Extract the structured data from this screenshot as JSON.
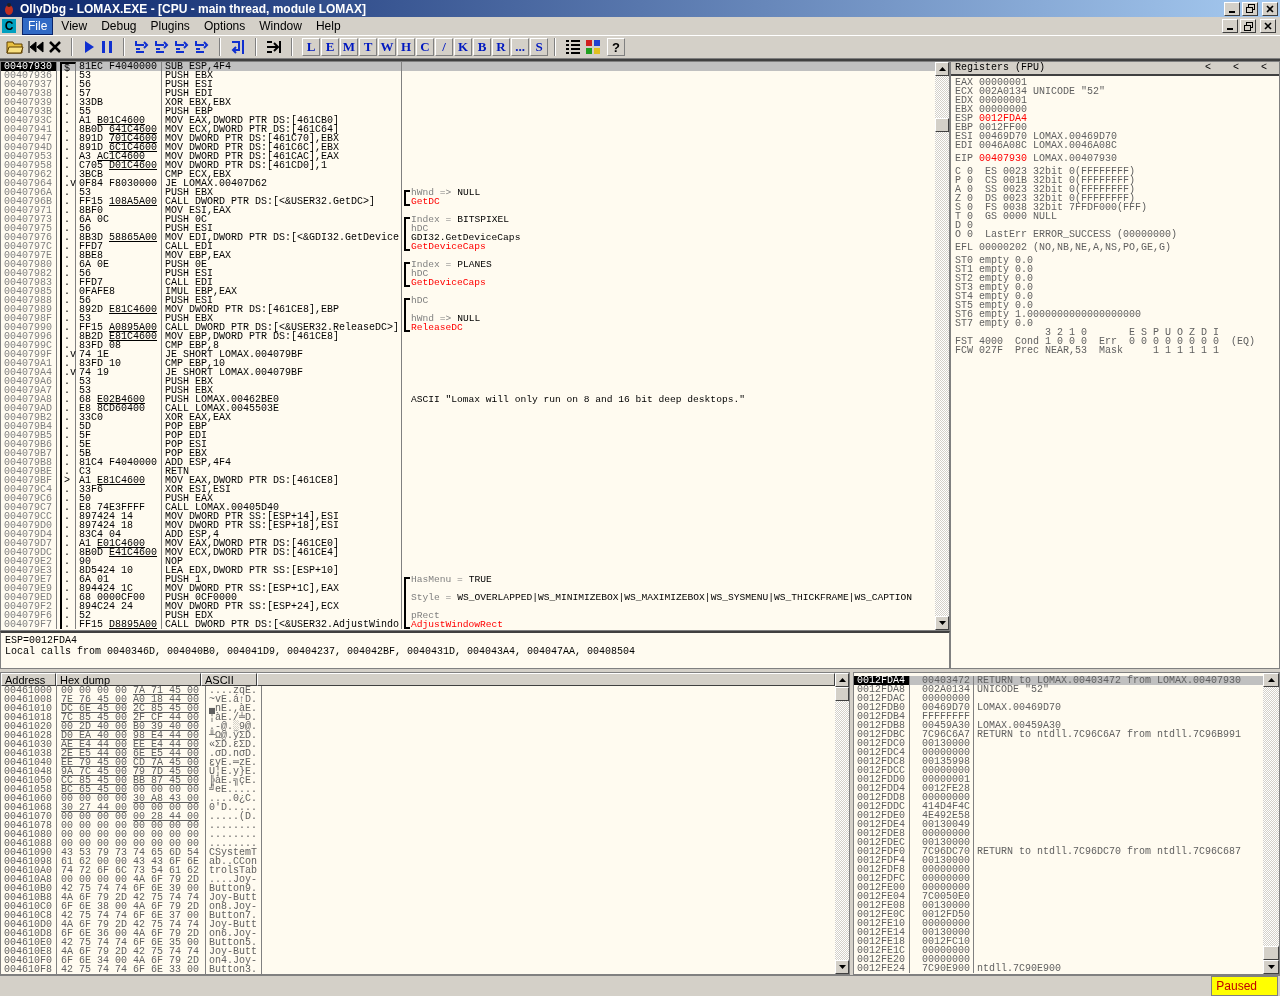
{
  "window": {
    "title": "OllyDbg - LOMAX.EXE - [CPU - main thread, module LOMAX]"
  },
  "menu": {
    "child_icon": "C",
    "items": [
      {
        "label": "File",
        "selected": true
      },
      {
        "label": "View",
        "selected": false
      },
      {
        "label": "Debug",
        "selected": false
      },
      {
        "label": "Plugins",
        "selected": false
      },
      {
        "label": "Options",
        "selected": false
      },
      {
        "label": "Window",
        "selected": false
      },
      {
        "label": "Help",
        "selected": false
      }
    ]
  },
  "toolbar": {
    "letters": [
      "L",
      "E",
      "M",
      "T",
      "W",
      "H",
      "C",
      "/",
      "K",
      "B",
      "R",
      "...",
      "S"
    ],
    "help": "?"
  },
  "disasm": {
    "rows": [
      {
        "address": "00407930",
        "mark": "$",
        "hex": "81EC F4040000",
        "asm": "SUB ESP,4F4",
        "selected": true
      },
      {
        "address": "00407936",
        "mark": ".",
        "hex": "53",
        "asm": "PUSH EBX",
        "selected": false
      },
      {
        "address": "00407937",
        "mark": ".",
        "hex": "56",
        "asm": "PUSH ESI",
        "selected": false
      },
      {
        "address": "00407938",
        "mark": ".",
        "hex": "57",
        "asm": "PUSH EDI",
        "selected": false
      },
      {
        "address": "00407939",
        "mark": ".",
        "hex": "33DB",
        "asm": "XOR EBX,EBX",
        "selected": false
      },
      {
        "address": "0040793B",
        "mark": ".",
        "hex": "55",
        "asm": "PUSH EBP",
        "selected": false
      },
      {
        "address": "0040793C",
        "mark": ".",
        "hex": "A1",
        "ref": "B01C4600",
        "asm": "MOV EAX,DWORD PTR DS:[461CB0]",
        "selected": false
      },
      {
        "address": "00407941",
        "mark": ".",
        "hex": "8B0D",
        "ref": "641C4600",
        "asm": "MOV ECX,DWORD PTR DS:[461C64]",
        "selected": false
      },
      {
        "address": "00407947",
        "mark": ".",
        "hex": "891D",
        "ref": "701C4600",
        "asm": "MOV DWORD PTR DS:[461C70],EBX",
        "selected": false
      },
      {
        "address": "0040794D",
        "mark": ".",
        "hex": "891D",
        "ref": "6C1C4600",
        "asm": "MOV DWORD PTR DS:[461C6C],EBX",
        "selected": false
      },
      {
        "address": "00407953",
        "mark": ".",
        "hex": "A3",
        "ref": "AC1C4600",
        "asm": "MOV DWORD PTR DS:[461CAC],EAX",
        "selected": false
      },
      {
        "address": "00407958",
        "mark": ".",
        "hex": "C705",
        "ref": "D01C4600",
        "asm": "MOV DWORD PTR DS:[461CD0],1",
        "selected": false
      },
      {
        "address": "00407962",
        "mark": ".",
        "hex": "3BCB",
        "asm": "CMP ECX,EBX",
        "selected": false
      },
      {
        "address": "00407964",
        "mark": ".v",
        "hex": "0F84 F8030000",
        "asm": "JE LOMAX.00407D62",
        "selected": false
      },
      {
        "address": "0040796A",
        "mark": ".",
        "hex": "53",
        "asm": "PUSH EBX",
        "kind": "open",
        "comment": {
          "kind": "arg",
          "label": "hWnd =>",
          "value": "NULL"
        },
        "selected": false
      },
      {
        "address": "0040796B",
        "mark": ".",
        "hex": "FF15",
        "ref": "108A5A00",
        "asm": "CALL DWORD PTR DS:[<&USER32.GetDC>]",
        "kind": "close",
        "comment": {
          "kind": "api",
          "text": "GetDC"
        },
        "selected": false
      },
      {
        "address": "00407971",
        "mark": ".",
        "hex": "8BF0",
        "asm": "MOV ESI,EAX",
        "selected": false
      },
      {
        "address": "00407973",
        "mark": ".",
        "hex": "6A 0C",
        "asm": "PUSH 0C",
        "kind": "open",
        "comment": {
          "kind": "arg",
          "label": "Index =",
          "value": "BITSPIXEL"
        },
        "selected": false
      },
      {
        "address": "00407975",
        "mark": ".",
        "hex": "56",
        "asm": "PUSH ESI",
        "kind": "inner",
        "comment": {
          "kind": "arg",
          "label": "hDC"
        },
        "selected": false
      },
      {
        "address": "00407976",
        "mark": ".",
        "hex": "8B3D",
        "ref": "58865A00",
        "asm": "MOV EDI,DWORD PTR DS:[<&GDI32.GetDevice",
        "kind": "inner",
        "comment": {
          "kind": "text",
          "text": "GDI32.GetDeviceCaps"
        },
        "selected": false
      },
      {
        "address": "0040797C",
        "mark": ".",
        "hex": "FFD7",
        "asm": "CALL EDI",
        "kind": "close",
        "comment": {
          "kind": "api",
          "text": "GetDeviceCaps"
        },
        "selected": false
      },
      {
        "address": "0040797E",
        "mark": ".",
        "hex": "8BE8",
        "asm": "MOV EBP,EAX",
        "selected": false
      },
      {
        "address": "00407980",
        "mark": ".",
        "hex": "6A 0E",
        "asm": "PUSH 0E",
        "kind": "open",
        "comment": {
          "kind": "arg",
          "label": "Index =",
          "value": "PLANES"
        },
        "selected": false
      },
      {
        "address": "00407982",
        "mark": ".",
        "hex": "56",
        "asm": "PUSH ESI",
        "kind": "inner",
        "comment": {
          "kind": "arg",
          "label": "hDC"
        },
        "selected": false
      },
      {
        "address": "00407983",
        "mark": ".",
        "hex": "FFD7",
        "asm": "CALL EDI",
        "kind": "close",
        "comment": {
          "kind": "api",
          "text": "GetDeviceCaps"
        },
        "selected": false
      },
      {
        "address": "00407985",
        "mark": ".",
        "hex": "0FAFE8",
        "asm": "IMUL EBP,EAX",
        "selected": false
      },
      {
        "address": "00407988",
        "mark": ".",
        "hex": "56",
        "asm": "PUSH ESI",
        "kind": "open",
        "comment": {
          "kind": "arg",
          "label": "hDC"
        },
        "selected": false
      },
      {
        "address": "00407989",
        "mark": ".",
        "hex": "892D",
        "ref": "E81C4600",
        "asm": "MOV DWORD PTR DS:[461CE8],EBP",
        "kind": "inner",
        "selected": false
      },
      {
        "address": "0040798F",
        "mark": ".",
        "hex": "53",
        "asm": "PUSH EBX",
        "kind": "inner",
        "comment": {
          "kind": "arg",
          "label": "hWnd =>",
          "value": "NULL"
        },
        "selected": false
      },
      {
        "address": "00407990",
        "mark": ".",
        "hex": "FF15",
        "ref": "A0895A00",
        "asm": "CALL DWORD PTR DS:[<&USER32.ReleaseDC>]",
        "kind": "close",
        "comment": {
          "kind": "api",
          "text": "ReleaseDC"
        },
        "selected": false
      },
      {
        "address": "00407996",
        "mark": ".",
        "hex": "8B2D",
        "ref": "E81C4600",
        "asm": "MOV EBP,DWORD PTR DS:[461CE8]",
        "selected": false
      },
      {
        "address": "0040799C",
        "mark": ".",
        "hex": "83FD 08",
        "asm": "CMP EBP,8",
        "selected": false
      },
      {
        "address": "0040799F",
        "mark": ".v",
        "hex": "74 1E",
        "asm": "JE SHORT LOMAX.004079BF",
        "selected": false
      },
      {
        "address": "004079A1",
        "mark": ".",
        "hex": "83FD 10",
        "asm": "CMP EBP,10",
        "selected": false
      },
      {
        "address": "004079A4",
        "mark": ".v",
        "hex": "74 19",
        "asm": "JE SHORT LOMAX.004079BF",
        "selected": false
      },
      {
        "address": "004079A6",
        "mark": ".",
        "hex": "53",
        "asm": "PUSH EBX",
        "selected": false
      },
      {
        "address": "004079A7",
        "mark": ".",
        "hex": "53",
        "asm": "PUSH EBX",
        "selected": false
      },
      {
        "address": "004079A8",
        "mark": ".",
        "hex": "68",
        "ref": "E02B4600",
        "asm": "PUSH LOMAX.00462BE0",
        "comment": {
          "kind": "text",
          "text": "ASCII \"Lomax will only run on 8 and 16 bit deep desktops.\""
        },
        "selected": false
      },
      {
        "address": "004079AD",
        "mark": ".",
        "hex": "E8 8CD60400",
        "asm": "CALL LOMAX.0045503E",
        "selected": false
      },
      {
        "address": "004079B2",
        "mark": ".",
        "hex": "33C0",
        "asm": "XOR EAX,EAX",
        "selected": false
      },
      {
        "address": "004079B4",
        "mark": ".",
        "hex": "5D",
        "asm": "POP EBP",
        "selected": false
      },
      {
        "address": "004079B5",
        "mark": ".",
        "hex": "5F",
        "asm": "POP EDI",
        "selected": false
      },
      {
        "address": "004079B6",
        "mark": ".",
        "hex": "5E",
        "asm": "POP ESI",
        "selected": false
      },
      {
        "address": "004079B7",
        "mark": ".",
        "hex": "5B",
        "asm": "POP EBX",
        "selected": false
      },
      {
        "address": "004079B8",
        "mark": ".",
        "hex": "81C4 F4040000",
        "asm": "ADD ESP,4F4",
        "selected": false
      },
      {
        "address": "004079BE",
        "mark": ".",
        "hex": "C3",
        "asm": "RETN",
        "selected": false
      },
      {
        "address": "004079BF",
        "mark": ">",
        "hex": "A1",
        "ref": "E81C4600",
        "asm": "MOV EAX,DWORD PTR DS:[461CE8]",
        "selected": false
      },
      {
        "address": "004079C4",
        "mark": ".",
        "hex": "33F6",
        "asm": "XOR ESI,ESI",
        "selected": false
      },
      {
        "address": "004079C6",
        "mark": ".",
        "hex": "50",
        "asm": "PUSH EAX",
        "selected": false
      },
      {
        "address": "004079C7",
        "mark": ".",
        "hex": "E8 74E3FFFF",
        "asm": "CALL LOMAX.00405D40",
        "selected": false
      },
      {
        "address": "004079CC",
        "mark": ".",
        "hex": "897424 14",
        "asm": "MOV DWORD PTR SS:[ESP+14],ESI",
        "selected": false
      },
      {
        "address": "004079D0",
        "mark": ".",
        "hex": "897424 18",
        "asm": "MOV DWORD PTR SS:[ESP+18],ESI",
        "selected": false
      },
      {
        "address": "004079D4",
        "mark": ".",
        "hex": "83C4 04",
        "asm": "ADD ESP,4",
        "selected": false
      },
      {
        "address": "004079D7",
        "mark": ".",
        "hex": "A1",
        "ref": "E01C4600",
        "asm": "MOV EAX,DWORD PTR DS:[461CE0]",
        "selected": false
      },
      {
        "address": "004079DC",
        "mark": ".",
        "hex": "8B0D",
        "ref": "E41C4600",
        "asm": "MOV ECX,DWORD PTR DS:[461CE4]",
        "selected": false
      },
      {
        "address": "004079E2",
        "mark": ".",
        "hex": "90",
        "asm": "NOP",
        "selected": false
      },
      {
        "address": "004079E3",
        "mark": ".",
        "hex": "8D5424 10",
        "asm": "LEA EDX,DWORD PTR SS:[ESP+10]",
        "selected": false
      },
      {
        "address": "004079E7",
        "mark": ".",
        "hex": "6A 01",
        "asm": "PUSH 1",
        "kind": "open",
        "comment": {
          "kind": "arg",
          "label": "HasMenu =",
          "value": "TRUE"
        },
        "selected": false
      },
      {
        "address": "004079E9",
        "mark": ".",
        "hex": "894424 1C",
        "asm": "MOV DWORD PTR SS:[ESP+1C],EAX",
        "kind": "inner",
        "selected": false
      },
      {
        "address": "004079ED",
        "mark": ".",
        "hex": "68 0000CF00",
        "asm": "PUSH 0CF0000",
        "kind": "inner",
        "comment": {
          "kind": "arg",
          "label": "Style =",
          "value": "WS_OVERLAPPED|WS_MINIMIZEBOX|WS_MAXIMIZEBOX|WS_SYSMENU|WS_THICKFRAME|WS_CAPTION"
        },
        "selected": false
      },
      {
        "address": "004079F2",
        "mark": ".",
        "hex": "894C24 24",
        "asm": "MOV DWORD PTR SS:[ESP+24],ECX",
        "kind": "inner",
        "selected": false
      },
      {
        "address": "004079F6",
        "mark": ".",
        "hex": "52",
        "asm": "PUSH EDX",
        "kind": "inner",
        "comment": {
          "kind": "arg",
          "label": "pRect"
        },
        "selected": false
      },
      {
        "address": "004079F7",
        "mark": ".",
        "hex": "FF15",
        "ref": "D8895A00",
        "asm": "CALL DWORD PTR DS:[<&USER32.AdjustWindo",
        "kind": "close",
        "comment": {
          "kind": "api",
          "text": "AdjustWindowRect"
        },
        "selected": false
      }
    ]
  },
  "info": {
    "lines": [
      "ESP=0012FDA4",
      "Local calls from 0040346D, 004040B0, 004041D9, 00404237, 004042BF, 0040431D, 004043A4, 004047AA, 00408504"
    ]
  },
  "registers": {
    "title": "Registers (FPU)",
    "arrows": [
      "<",
      "<",
      "<"
    ],
    "general": [
      {
        "name": "EAX",
        "value": "00000001",
        "changed": false
      },
      {
        "name": "ECX",
        "value": "002A0134",
        "note": "UNICODE \"52\"",
        "changed": false
      },
      {
        "name": "EDX",
        "value": "00000001",
        "changed": false
      },
      {
        "name": "EBX",
        "value": "00000000",
        "changed": false
      },
      {
        "name": "ESP",
        "value": "0012FDA4",
        "changed": true
      },
      {
        "name": "EBP",
        "value": "0012FF00",
        "changed": false
      },
      {
        "name": "ESI",
        "value": "00469D70",
        "note": "LOMAX.00469D70",
        "changed": false
      },
      {
        "name": "EDI",
        "value": "0046A08C",
        "note": "LOMAX.0046A08C",
        "changed": false
      }
    ],
    "eip": {
      "name": "EIP",
      "value": "00407930",
      "note": "LOMAX.00407930",
      "changed": true
    },
    "flags": [
      {
        "flag": "C",
        "value": "0",
        "segment": "ES 0023 32bit 0(FFFFFFFF)"
      },
      {
        "flag": "P",
        "value": "0",
        "segment": "CS 001B 32bit 0(FFFFFFFF)"
      },
      {
        "flag": "A",
        "value": "0",
        "segment": "SS 0023 32bit 0(FFFFFFFF)"
      },
      {
        "flag": "Z",
        "value": "0",
        "segment": "DS 0023 32bit 0(FFFFFFFF)"
      },
      {
        "flag": "S",
        "value": "0",
        "segment": "FS 0038 32bit 7FFDF000(FFF)"
      },
      {
        "flag": "T",
        "value": "0",
        "segment": "GS 0000 NULL"
      },
      {
        "flag": "D",
        "value": "0"
      },
      {
        "flag": "O",
        "value": "0",
        "segment": "LastErr ERROR_SUCCESS (00000000)"
      }
    ],
    "efl": {
      "name": "EFL",
      "value": "00000202",
      "decoded": "(NO,NB,NE,A,NS,PO,GE,G)"
    },
    "fpu": [
      {
        "name": "ST0",
        "tag": "empty",
        "value": "0.0"
      },
      {
        "name": "ST1",
        "tag": "empty",
        "value": "0.0"
      },
      {
        "name": "ST2",
        "tag": "empty",
        "value": "0.0"
      },
      {
        "name": "ST3",
        "tag": "empty",
        "value": "0.0"
      },
      {
        "name": "ST4",
        "tag": "empty",
        "value": "0.0"
      },
      {
        "name": "ST5",
        "tag": "empty",
        "value": "0.0"
      },
      {
        "name": "ST6",
        "tag": "empty",
        "value": "1.0000000000000000000"
      },
      {
        "name": "ST7",
        "tag": "empty",
        "value": "0.0"
      }
    ],
    "fpu_status": {
      "cond_header": "3 2 1 0",
      "err_header": "E S P U O Z D I",
      "rows": [
        {
          "name": "FST",
          "value": "4000",
          "label1": "Cond",
          "bits1": "1 0 0 0",
          "label2": "Err",
          "bits2": "0 0 0 0 0 0 0 0",
          "note": "(EQ)"
        },
        {
          "name": "FCW",
          "value": "027F",
          "label1": "Prec",
          "bits1": "NEAR,53",
          "label2": "Mask",
          "bits2": "1 1 1 1 1 1"
        }
      ]
    }
  },
  "dump": {
    "columns": [
      "Address",
      "Hex dump",
      "ASCII"
    ],
    "rows": [
      {
        "address": "00461000",
        "bytes": [
          "00 00 00 00",
          "7A 71 45 00"
        ],
        "ref": [
          false,
          true
        ],
        "ascii": "....zqE."
      },
      {
        "address": "00461008",
        "bytes": [
          "7E 76 45 00",
          "A0 18 44 00"
        ],
        "ref": [
          true,
          true
        ],
        "ascii": "~vE.á↑D."
      },
      {
        "address": "00461010",
        "bytes": [
          "DC 6E 45 00",
          "2C 85 45 00"
        ],
        "ref": [
          true,
          true
        ],
        "ascii": "▄nE.,àE."
      },
      {
        "address": "00461018",
        "bytes": [
          "7C 85 45 00",
          "2F CF 44 00"
        ],
        "ref": [
          true,
          true
        ],
        "ascii": "¦àE./╧D."
      },
      {
        "address": "00461020",
        "bytes": [
          "00 2D 40 00",
          "B0 39 40 00"
        ],
        "ref": [
          true,
          true
        ],
        "ascii": ".-@.░9@."
      },
      {
        "address": "00461028",
        "bytes": [
          "D0 EA 40 00",
          "98 E4 44 00"
        ],
        "ref": [
          true,
          true
        ],
        "ascii": "╨Ω@.ÿΣD."
      },
      {
        "address": "00461030",
        "bytes": [
          "AE E4 44 00",
          "EE E4 44 00"
        ],
        "ref": [
          true,
          true
        ],
        "ascii": "«ΣD.εΣD."
      },
      {
        "address": "00461038",
        "bytes": [
          "2E E5 44 00",
          "6E E5 44 00"
        ],
        "ref": [
          true,
          true
        ],
        "ascii": ".σD.nσD."
      },
      {
        "address": "00461040",
        "bytes": [
          "EE 79 45 00",
          "CD 7A 45 00"
        ],
        "ref": [
          true,
          true
        ],
        "ascii": "εyE.═zE."
      },
      {
        "address": "00461048",
        "bytes": [
          "9A 7C 45 00",
          "79 7D 45 00"
        ],
        "ref": [
          true,
          true
        ],
        "ascii": "Ü¦E.y}E."
      },
      {
        "address": "00461050",
        "bytes": [
          "CC 85 45 00",
          "BB 87 45 00"
        ],
        "ref": [
          true,
          true
        ],
        "ascii": "╠àE.╗çE."
      },
      {
        "address": "00461058",
        "bytes": [
          "BC 65 45 00",
          "00 00 00 00"
        ],
        "ref": [
          true,
          false
        ],
        "ascii": "╝eE....."
      },
      {
        "address": "00461060",
        "bytes": [
          "00 00 00 00",
          "30 A8 43 00"
        ],
        "ref": [
          false,
          true
        ],
        "ascii": "....0¿C."
      },
      {
        "address": "00461068",
        "bytes": [
          "30 27 44 00",
          "00 00 00 00"
        ],
        "ref": [
          true,
          false
        ],
        "ascii": "0'D....."
      },
      {
        "address": "00461070",
        "bytes": [
          "00 00 00 00",
          "00 28 44 00"
        ],
        "ref": [
          false,
          true
        ],
        "ascii": ".....(D."
      },
      {
        "address": "00461078",
        "bytes": [
          "00 00 00 00",
          "00 00 00 00"
        ],
        "ref": [
          false,
          false
        ],
        "ascii": "........"
      },
      {
        "address": "00461080",
        "bytes": [
          "00 00 00 00",
          "00 00 00 00"
        ],
        "ref": [
          false,
          false
        ],
        "ascii": "........"
      },
      {
        "address": "00461088",
        "bytes": [
          "00 00 00 00",
          "00 00 00 00"
        ],
        "ref": [
          false,
          false
        ],
        "ascii": "........"
      },
      {
        "address": "00461090",
        "bytes": [
          "43 53 79 73",
          "74 65 6D 54"
        ],
        "ref": [
          false,
          false
        ],
        "ascii": "CSystemT"
      },
      {
        "address": "00461098",
        "bytes": [
          "61 62 00 00",
          "43 43 6F 6E"
        ],
        "ref": [
          false,
          false
        ],
        "ascii": "ab..CCon"
      },
      {
        "address": "004610A0",
        "bytes": [
          "74 72 6F 6C",
          "73 54 61 62"
        ],
        "ref": [
          false,
          false
        ],
        "ascii": "trolsTab"
      },
      {
        "address": "004610A8",
        "bytes": [
          "00 00 00 00",
          "4A 6F 79 2D"
        ],
        "ref": [
          false,
          false
        ],
        "ascii": "....Joy-"
      },
      {
        "address": "004610B0",
        "bytes": [
          "42 75 74 74",
          "6F 6E 39 00"
        ],
        "ref": [
          false,
          false
        ],
        "ascii": "Button9."
      },
      {
        "address": "004610B8",
        "bytes": [
          "4A 6F 79 2D",
          "42 75 74 74"
        ],
        "ref": [
          false,
          false
        ],
        "ascii": "Joy-Butt"
      },
      {
        "address": "004610C0",
        "bytes": [
          "6F 6E 38 00",
          "4A 6F 79 2D"
        ],
        "ref": [
          false,
          false
        ],
        "ascii": "on8.Joy-"
      },
      {
        "address": "004610C8",
        "bytes": [
          "42 75 74 74",
          "6F 6E 37 00"
        ],
        "ref": [
          false,
          false
        ],
        "ascii": "Button7."
      },
      {
        "address": "004610D0",
        "bytes": [
          "4A 6F 79 2D",
          "42 75 74 74"
        ],
        "ref": [
          false,
          false
        ],
        "ascii": "Joy-Butt"
      },
      {
        "address": "004610D8",
        "bytes": [
          "6F 6E 36 00",
          "4A 6F 79 2D"
        ],
        "ref": [
          false,
          false
        ],
        "ascii": "on6.Joy-"
      },
      {
        "address": "004610E0",
        "bytes": [
          "42 75 74 74",
          "6F 6E 35 00"
        ],
        "ref": [
          false,
          false
        ],
        "ascii": "Button5."
      },
      {
        "address": "004610E8",
        "bytes": [
          "4A 6F 79 2D",
          "42 75 74 74"
        ],
        "ref": [
          false,
          false
        ],
        "ascii": "Joy-Butt"
      },
      {
        "address": "004610F0",
        "bytes": [
          "6F 6E 34 00",
          "4A 6F 79 2D"
        ],
        "ref": [
          false,
          false
        ],
        "ascii": "on4.Joy-"
      },
      {
        "address": "004610F8",
        "bytes": [
          "42 75 74 74",
          "6F 6E 33 00"
        ],
        "ref": [
          false,
          false
        ],
        "ascii": "Button3."
      }
    ]
  },
  "stack": {
    "rows": [
      {
        "address": "0012FDA4",
        "value": "00403472",
        "comment": "RETURN to LOMAX.00403472 from LOMAX.00407930",
        "selected": true
      },
      {
        "address": "0012FDA8",
        "value": "002A0134",
        "comment": "UNICODE \"52\"",
        "selected": false
      },
      {
        "address": "0012FDAC",
        "value": "00000000",
        "selected": false
      },
      {
        "address": "0012FDB0",
        "value": "00469D70",
        "comment": "LOMAX.00469D70",
        "selected": false
      },
      {
        "address": "0012FDB4",
        "value": "FFFFFFFF",
        "selected": false
      },
      {
        "address": "0012FDB8",
        "value": "00459A30",
        "comment": "LOMAX.00459A30",
        "selected": false
      },
      {
        "address": "0012FDBC",
        "value": "7C96C6A7",
        "comment": "RETURN to ntdll.7C96C6A7 from ntdll.7C96B991",
        "selected": false
      },
      {
        "address": "0012FDC0",
        "value": "00130000",
        "selected": false
      },
      {
        "address": "0012FDC4",
        "value": "00000000",
        "selected": false
      },
      {
        "address": "0012FDC8",
        "value": "00135998",
        "selected": false
      },
      {
        "address": "0012FDCC",
        "value": "00000000",
        "selected": false
      },
      {
        "address": "0012FDD0",
        "value": "00000001",
        "selected": false
      },
      {
        "address": "0012FDD4",
        "value": "0012FE28",
        "selected": false
      },
      {
        "address": "0012FDD8",
        "value": "00000000",
        "selected": false
      },
      {
        "address": "0012FDDC",
        "value": "414D4F4C",
        "selected": false
      },
      {
        "address": "0012FDE0",
        "value": "4E492E58",
        "selected": false
      },
      {
        "address": "0012FDE4",
        "value": "00130049",
        "selected": false
      },
      {
        "address": "0012FDE8",
        "value": "00000000",
        "selected": false
      },
      {
        "address": "0012FDEC",
        "value": "00130000",
        "selected": false
      },
      {
        "address": "0012FDF0",
        "value": "7C96DC70",
        "comment": "RETURN to ntdll.7C96DC70 from ntdll.7C96C687",
        "selected": false
      },
      {
        "address": "0012FDF4",
        "value": "00130000",
        "selected": false
      },
      {
        "address": "0012FDF8",
        "value": "00000000",
        "selected": false
      },
      {
        "address": "0012FDFC",
        "value": "00000000",
        "selected": false
      },
      {
        "address": "0012FE00",
        "value": "00000000",
        "selected": false
      },
      {
        "address": "0012FE04",
        "value": "7C0050E0",
        "selected": false
      },
      {
        "address": "0012FE08",
        "value": "00130000",
        "selected": false
      },
      {
        "address": "0012FE0C",
        "value": "0012FD50",
        "selected": false
      },
      {
        "address": "0012FE10",
        "value": "00000000",
        "selected": false
      },
      {
        "address": "0012FE14",
        "value": "00130000",
        "selected": false
      },
      {
        "address": "0012FE18",
        "value": "0012FC10",
        "selected": false
      },
      {
        "address": "0012FE1C",
        "value": "00000000",
        "selected": false
      },
      {
        "address": "0012FE20",
        "value": "00000000",
        "selected": false
      },
      {
        "address": "0012FE24",
        "value": "7C90E900",
        "comment": "ntdll.7C90E900",
        "selected": false
      }
    ]
  },
  "status_bar": {
    "state": "Paused"
  }
}
